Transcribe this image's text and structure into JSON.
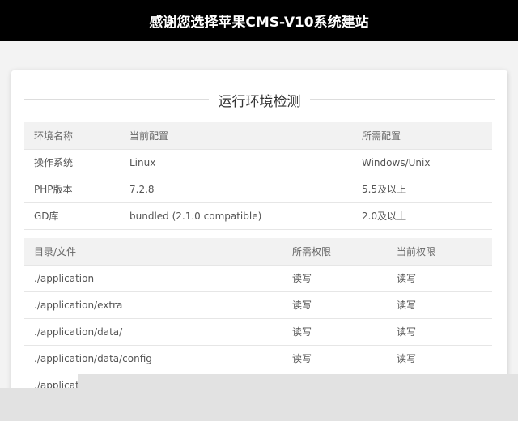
{
  "header": {
    "title": "感谢您选择苹果CMS-V10系统建站"
  },
  "section": {
    "title": "运行环境检测"
  },
  "env_table": {
    "headers": [
      "环境名称",
      "当前配置",
      "所需配置"
    ],
    "rows": [
      [
        "操作系统",
        "Linux",
        "Windows/Unix"
      ],
      [
        "PHP版本",
        "7.2.8",
        "5.5及以上"
      ],
      [
        "GD库",
        "bundled (2.1.0 compatible)",
        "2.0及以上"
      ]
    ]
  },
  "dir_table": {
    "headers": [
      "目录/文件",
      "所需权限",
      "当前权限"
    ],
    "rows": [
      [
        "./application",
        "读写",
        "读写"
      ],
      [
        "./application/extra",
        "读写",
        "读写"
      ],
      [
        "./application/data/",
        "读写",
        "读写"
      ],
      [
        "./application/data/config",
        "读写",
        "读写"
      ],
      [
        "./applicati",
        "",
        ""
      ]
    ]
  }
}
